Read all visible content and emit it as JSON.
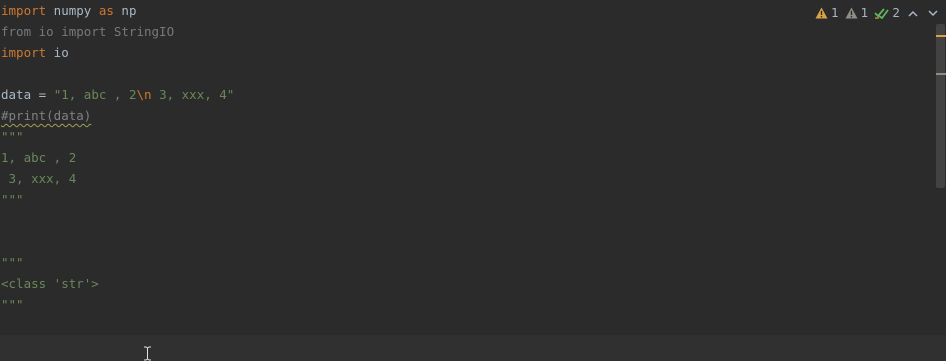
{
  "editor": {
    "lines": [
      [
        {
          "t": "import",
          "c": "kw"
        },
        {
          "t": " numpy ",
          "c": "plain"
        },
        {
          "t": "as",
          "c": "kw"
        },
        {
          "t": " np",
          "c": "plain"
        }
      ],
      [
        {
          "t": "from io import StringIO",
          "c": "dim"
        }
      ],
      [
        {
          "t": "import",
          "c": "kw"
        },
        {
          "t": " io",
          "c": "plain"
        }
      ],
      [],
      [
        {
          "t": "data = ",
          "c": "plain"
        },
        {
          "t": "\"1, abc , 2",
          "c": "str"
        },
        {
          "t": "\\n",
          "c": "esc"
        },
        {
          "t": " 3, xxx, 4\"",
          "c": "str"
        }
      ],
      [
        {
          "t": "#print(data)",
          "c": "cmt"
        }
      ],
      [
        {
          "t": "\"\"\"",
          "c": "str"
        }
      ],
      [
        {
          "t": "1, abc , 2",
          "c": "str"
        }
      ],
      [
        {
          "t": " 3, xxx, 4",
          "c": "str"
        }
      ],
      [
        {
          "t": "\"\"\"",
          "c": "str"
        }
      ],
      [],
      [],
      [
        {
          "t": "\"\"\"",
          "c": "str"
        }
      ],
      [
        {
          "t": "<class 'str'>",
          "c": "str"
        }
      ],
      [
        {
          "t": "\"\"\"",
          "c": "str"
        }
      ]
    ]
  },
  "inspections": {
    "warnings": "1",
    "weak_warnings": "1",
    "typos": "2",
    "warning_icon": "warning-triangle-icon",
    "weak_warning_icon": "weak-warning-triangle-icon",
    "typo_icon": "double-check-icon",
    "prev_icon": "chevron-up-icon",
    "next_icon": "chevron-down-icon"
  },
  "colors": {
    "background": "#2b2b2b",
    "keyword": "#cc7832",
    "string": "#6a8759",
    "text": "#a9b7c6",
    "comment": "#808080",
    "warning": "#d9a343",
    "typo_check": "#5fb65f"
  }
}
